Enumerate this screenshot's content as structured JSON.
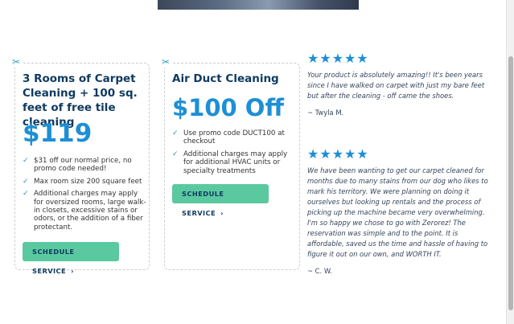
{
  "offers": [
    {
      "title": "3 Rooms of Carpet Cleaning + 100 sq. feet of free tile cleaning",
      "price": "$119",
      "features": [
        "$31 off our normal price, no promo code needed!",
        "Max room size 200 square feet",
        "Additional charges may apply for oversized rooms, large walk-in closets, excessive stains or odors, or the addition of a fiber protectant."
      ],
      "button_label": "SCHEDULE SERVICE"
    },
    {
      "title": "Air Duct Cleaning",
      "price": "$100 Off",
      "features": [
        "Use promo code DUCT100 at checkout",
        "Additional charges may apply for additional HVAC units or specialty treatments"
      ],
      "button_label": "SCHEDULE SERVICE"
    }
  ],
  "reviews": [
    {
      "stars": "★★★★★",
      "text": "Your product is absolutely amazing!! It's been years since I have walked on carpet with just my bare feet but after the cleaning - off came the shoes.",
      "author": "~ Twyla M."
    },
    {
      "stars": "★★★★★",
      "text": "We have been wanting to get our carpet cleaned for months due to many stains from our dog who likes to mark his territory. We were planning on doing it ourselves but looking up rentals and the process of picking up the machine became very overwhelming. I'm so happy we chose to go with Zerorez! The reservation was simple and to the point. It is affordable, saved us the time and hassle of having to figure it out on our own, and WORTH IT.",
      "author": "~ C. W."
    }
  ],
  "icons": {
    "scissors": "scissors-icon",
    "check": "checkmark-icon",
    "chevron": "chevron-right-icon",
    "star": "star-icon"
  },
  "colors": {
    "accent": "#1d8fd6",
    "heading": "#0f3a5f",
    "button": "#5bc9a0"
  }
}
